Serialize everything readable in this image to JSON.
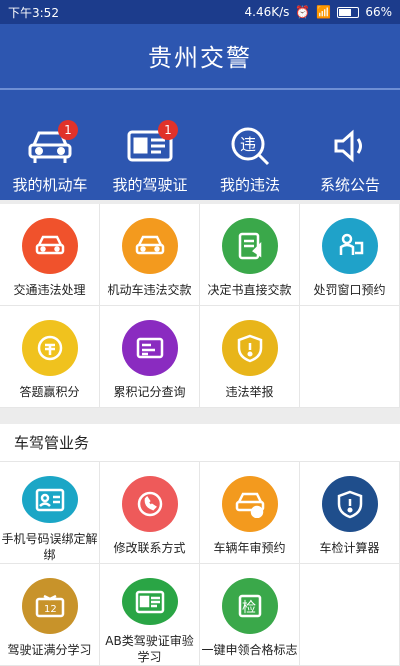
{
  "status": {
    "time": "下午3:52",
    "speed": "4.46K/s",
    "battery": "66%"
  },
  "header": {
    "title": "贵州交警"
  },
  "topnav": [
    {
      "label": "我的机动车",
      "badge": "1",
      "icon": "car-icon"
    },
    {
      "label": "我的驾驶证",
      "badge": "1",
      "icon": "license-card-icon"
    },
    {
      "label": "我的违法",
      "badge": "",
      "icon": "violation-search-icon"
    },
    {
      "label": "系统公告",
      "badge": "",
      "icon": "speaker-icon"
    }
  ],
  "grid1": [
    {
      "label": "交通违法处理",
      "color": "#f0522c",
      "icon": "car-icon"
    },
    {
      "label": "机动车违法交款",
      "color": "#f39a1e",
      "icon": "car-icon"
    },
    {
      "label": "决定书直接交款",
      "color": "#3aa84a",
      "icon": "document-icon"
    },
    {
      "label": "处罚窗口预约",
      "color": "#1fa2c9",
      "icon": "person-desk-icon"
    },
    {
      "label": "答题赢积分",
      "color": "#f0c21e",
      "icon": "coin-icon"
    },
    {
      "label": "累积记分查询",
      "color": "#8a2bc0",
      "icon": "card-icon"
    },
    {
      "label": "违法举报",
      "color": "#e8b51a",
      "icon": "shield-icon"
    }
  ],
  "section": {
    "title": "车驾管业务"
  },
  "grid2": [
    {
      "label": "手机号码误绑定解绑",
      "color": "#1ba6c6",
      "icon": "id-card-icon"
    },
    {
      "label": "修改联系方式",
      "color": "#ee5a5a",
      "icon": "phone-icon"
    },
    {
      "label": "车辆年审预约",
      "color": "#f39a1e",
      "icon": "car-check-icon"
    },
    {
      "label": "车检计算器",
      "color": "#1f4e8c",
      "icon": "shield-icon"
    },
    {
      "label": "驾驶证满分学习",
      "color": "#c8932a",
      "icon": "score-board-icon"
    },
    {
      "label": "AB类驾驶证审验学习",
      "color": "#2aa545",
      "icon": "license-card-icon"
    },
    {
      "label": "一键申领合格标志",
      "color": "#3aa84a",
      "icon": "inspection-stamp-icon"
    },
    {
      "label": "",
      "color": "#ffffff",
      "icon": ""
    }
  ]
}
